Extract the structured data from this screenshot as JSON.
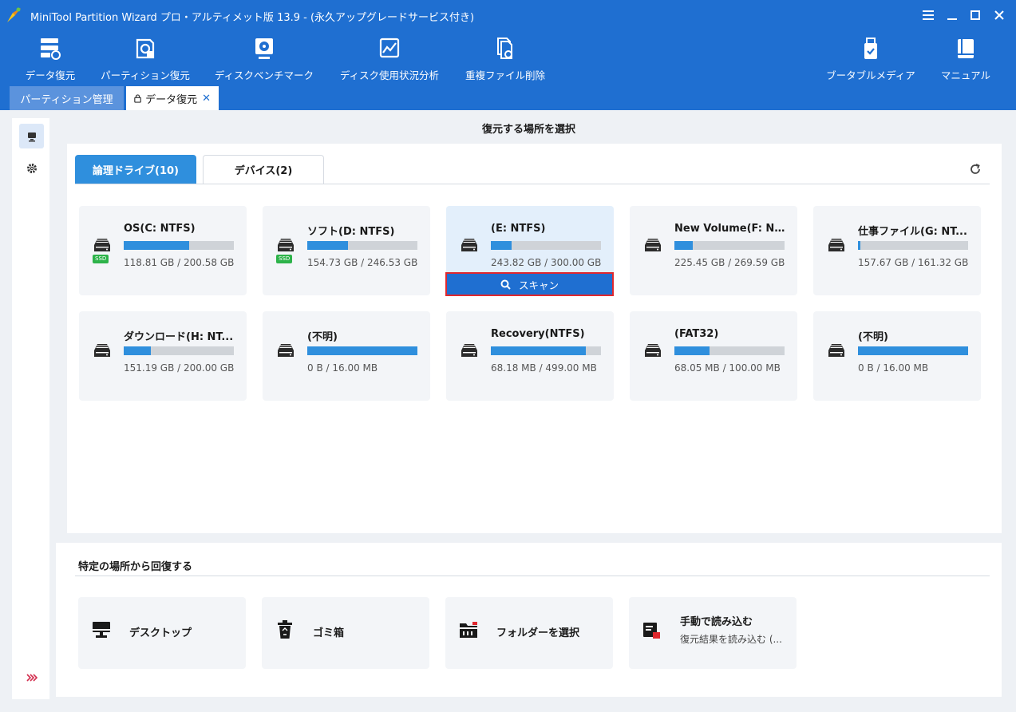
{
  "window": {
    "title": "MiniTool Partition Wizard プロ・アルティメット版 13.9 - (永久アップグレードサービス付き)",
    "controls": [
      "menu-icon",
      "minimize-icon",
      "maximize-icon",
      "close-icon"
    ]
  },
  "toolbar": {
    "items": [
      {
        "label": "データ復元",
        "icon": "data-recovery-icon"
      },
      {
        "label": "パーティション復元",
        "icon": "partition-recovery-icon"
      },
      {
        "label": "ディスクベンチマーク",
        "icon": "disk-benchmark-icon"
      },
      {
        "label": "ディスク使用状況分析",
        "icon": "space-analyzer-icon"
      },
      {
        "label": "重複ファイル削除",
        "icon": "duplicate-file-icon"
      },
      {
        "label": "ブータブルメディア",
        "icon": "bootable-media-icon"
      },
      {
        "label": "マニュアル",
        "icon": "manual-icon"
      }
    ]
  },
  "tabs": {
    "partition": "パーティション管理",
    "data_recovery": "データ復元"
  },
  "main": {
    "title": "復元する場所を選択",
    "tab_logical": "論理ドライブ(10)",
    "tab_devices": "デバイス(2)",
    "scan_label": "スキャン",
    "drives": [
      {
        "name": "OS(C: NTFS)",
        "size": "118.81 GB / 200.58 GB",
        "ssd": "SSD",
        "used": 0.592
      },
      {
        "name": "ソフト(D: NTFS)",
        "size": "154.73 GB / 246.53 GB",
        "ssd": "SSD",
        "used": 0.372
      },
      {
        "name": "(E: NTFS)",
        "size": "243.82 GB / 300.00 GB",
        "ssd": "",
        "used": 0.187
      },
      {
        "name": "New Volume(F: NTFS)",
        "size": "225.45 GB / 269.59 GB",
        "ssd": "",
        "used": 0.164
      },
      {
        "name": "仕事ファイル(G: NT...",
        "size": "157.67 GB / 161.32 GB",
        "ssd": "",
        "used": 0.023
      },
      {
        "name": "ダウンロード(H: NT...",
        "size": "151.19 GB / 200.00 GB",
        "ssd": "",
        "used": 0.244
      },
      {
        "name": "(不明)",
        "size": "0 B / 16.00 MB",
        "ssd": "",
        "used": 1.0
      },
      {
        "name": "Recovery(NTFS)",
        "size": "68.18 MB / 499.00 MB",
        "ssd": "",
        "used": 0.863
      },
      {
        "name": "(FAT32)",
        "size": "68.05 MB / 100.00 MB",
        "ssd": "",
        "used": 0.32
      },
      {
        "name": "(不明)",
        "size": "0 B / 16.00 MB",
        "ssd": "",
        "used": 1.0
      }
    ]
  },
  "specific": {
    "title": "特定の場所から回復する",
    "items": [
      {
        "label": "デスクトップ",
        "icon": "desktop-icon"
      },
      {
        "label": "ゴミ箱",
        "icon": "recycle-bin-icon"
      },
      {
        "label": "フォルダーを選択",
        "icon": "folder-icon"
      },
      {
        "label": "手動で読み込む",
        "sub": "復元結果を読み込む (...",
        "icon": "load-manually-icon"
      }
    ]
  },
  "colors": {
    "titlebar": "#1f6fd1",
    "accent": "#2f8fdd",
    "selected_card": "#e3effb",
    "scan_border": "#e0282e",
    "ssd_badge": "#2db34a"
  }
}
